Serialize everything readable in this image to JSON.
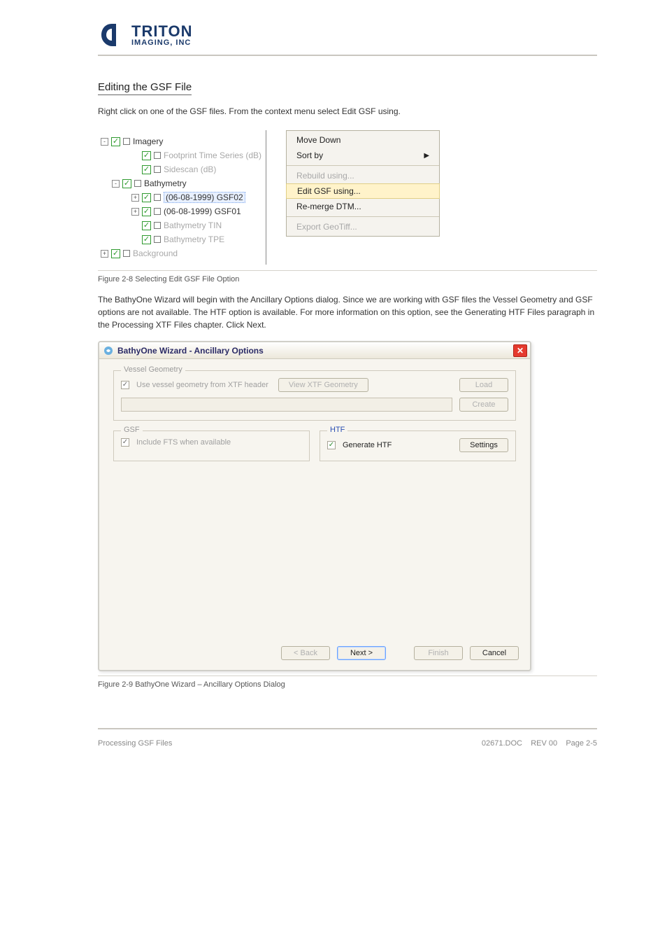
{
  "logo": {
    "line1": "TRITON",
    "line2": "IMAGING, INC"
  },
  "section_title": "Editing the GSF File",
  "intro_text": "Right click on one of the GSF files.  From the context menu select Edit GSF using.",
  "tree": {
    "items": [
      {
        "exp": "-",
        "indent": 0,
        "dim": false,
        "sel": false,
        "label": "Imagery"
      },
      {
        "exp": "",
        "indent": 2,
        "dim": true,
        "sel": false,
        "label": "Footprint Time Series (dB)"
      },
      {
        "exp": "",
        "indent": 2,
        "dim": true,
        "sel": false,
        "label": "Sidescan (dB)"
      },
      {
        "exp": "-",
        "indent": 1,
        "dim": false,
        "sel": false,
        "label": "Bathymetry"
      },
      {
        "exp": "+",
        "indent": 2,
        "dim": false,
        "sel": true,
        "label": "(06-08-1999) GSF02"
      },
      {
        "exp": "+",
        "indent": 2,
        "dim": false,
        "sel": false,
        "label": "(06-08-1999) GSF01"
      },
      {
        "exp": "",
        "indent": 2,
        "dim": true,
        "sel": false,
        "label": "Bathymetry TIN"
      },
      {
        "exp": "",
        "indent": 2,
        "dim": true,
        "sel": false,
        "label": "Bathymetry TPE"
      },
      {
        "exp": "+",
        "indent": 0,
        "dim": true,
        "sel": false,
        "label": "Background"
      }
    ]
  },
  "context_menu": {
    "items": [
      {
        "label": "Move Down",
        "dim": false,
        "arrow": false,
        "hover": false
      },
      {
        "label": "Sort by",
        "dim": false,
        "arrow": true,
        "hover": false
      },
      {
        "sep": true
      },
      {
        "label": "Rebuild using...",
        "dim": true,
        "arrow": false,
        "hover": false
      },
      {
        "label": "Edit GSF using...",
        "dim": false,
        "arrow": false,
        "hover": true
      },
      {
        "label": "Re-merge DTM...",
        "dim": false,
        "arrow": false,
        "hover": false
      },
      {
        "sep": true
      },
      {
        "label": "Export GeoTiff...",
        "dim": true,
        "arrow": false,
        "hover": false
      }
    ]
  },
  "fig1_caption": "Figure 2-8 Selecting Edit GSF File Option",
  "mid_text": "The BathyOne Wizard will begin with the Ancillary Options dialog.  Since we are working with GSF files the Vessel Geometry and GSF options are not available.  The HTF option is available.  For more information on this option, see the Generating HTF Files paragraph in the Processing XTF Files chapter.  Click Next.",
  "dialog": {
    "title": "BathyOne Wizard - Ancillary Options",
    "vessel": {
      "legend": "Vessel Geometry",
      "cb_label": "Use vessel geometry from XTF header",
      "view_btn": "View XTF Geometry",
      "load_btn": "Load",
      "create_btn": "Create"
    },
    "gsf": {
      "legend": "GSF",
      "cb_label": "Include FTS when available"
    },
    "htf": {
      "legend": "HTF",
      "cb_label": "Generate HTF",
      "settings_btn": "Settings"
    },
    "footer": {
      "back": "< Back",
      "next": "Next >",
      "finish": "Finish",
      "cancel": "Cancel"
    }
  },
  "fig2_caption": "Figure 2-9 BathyOne Wizard – Ancillary Options Dialog",
  "footer": {
    "left": "Processing GSF Files",
    "right_docid": "02671.DOC",
    "right_rev": "REV 00",
    "right_page": "Page 2-5"
  }
}
